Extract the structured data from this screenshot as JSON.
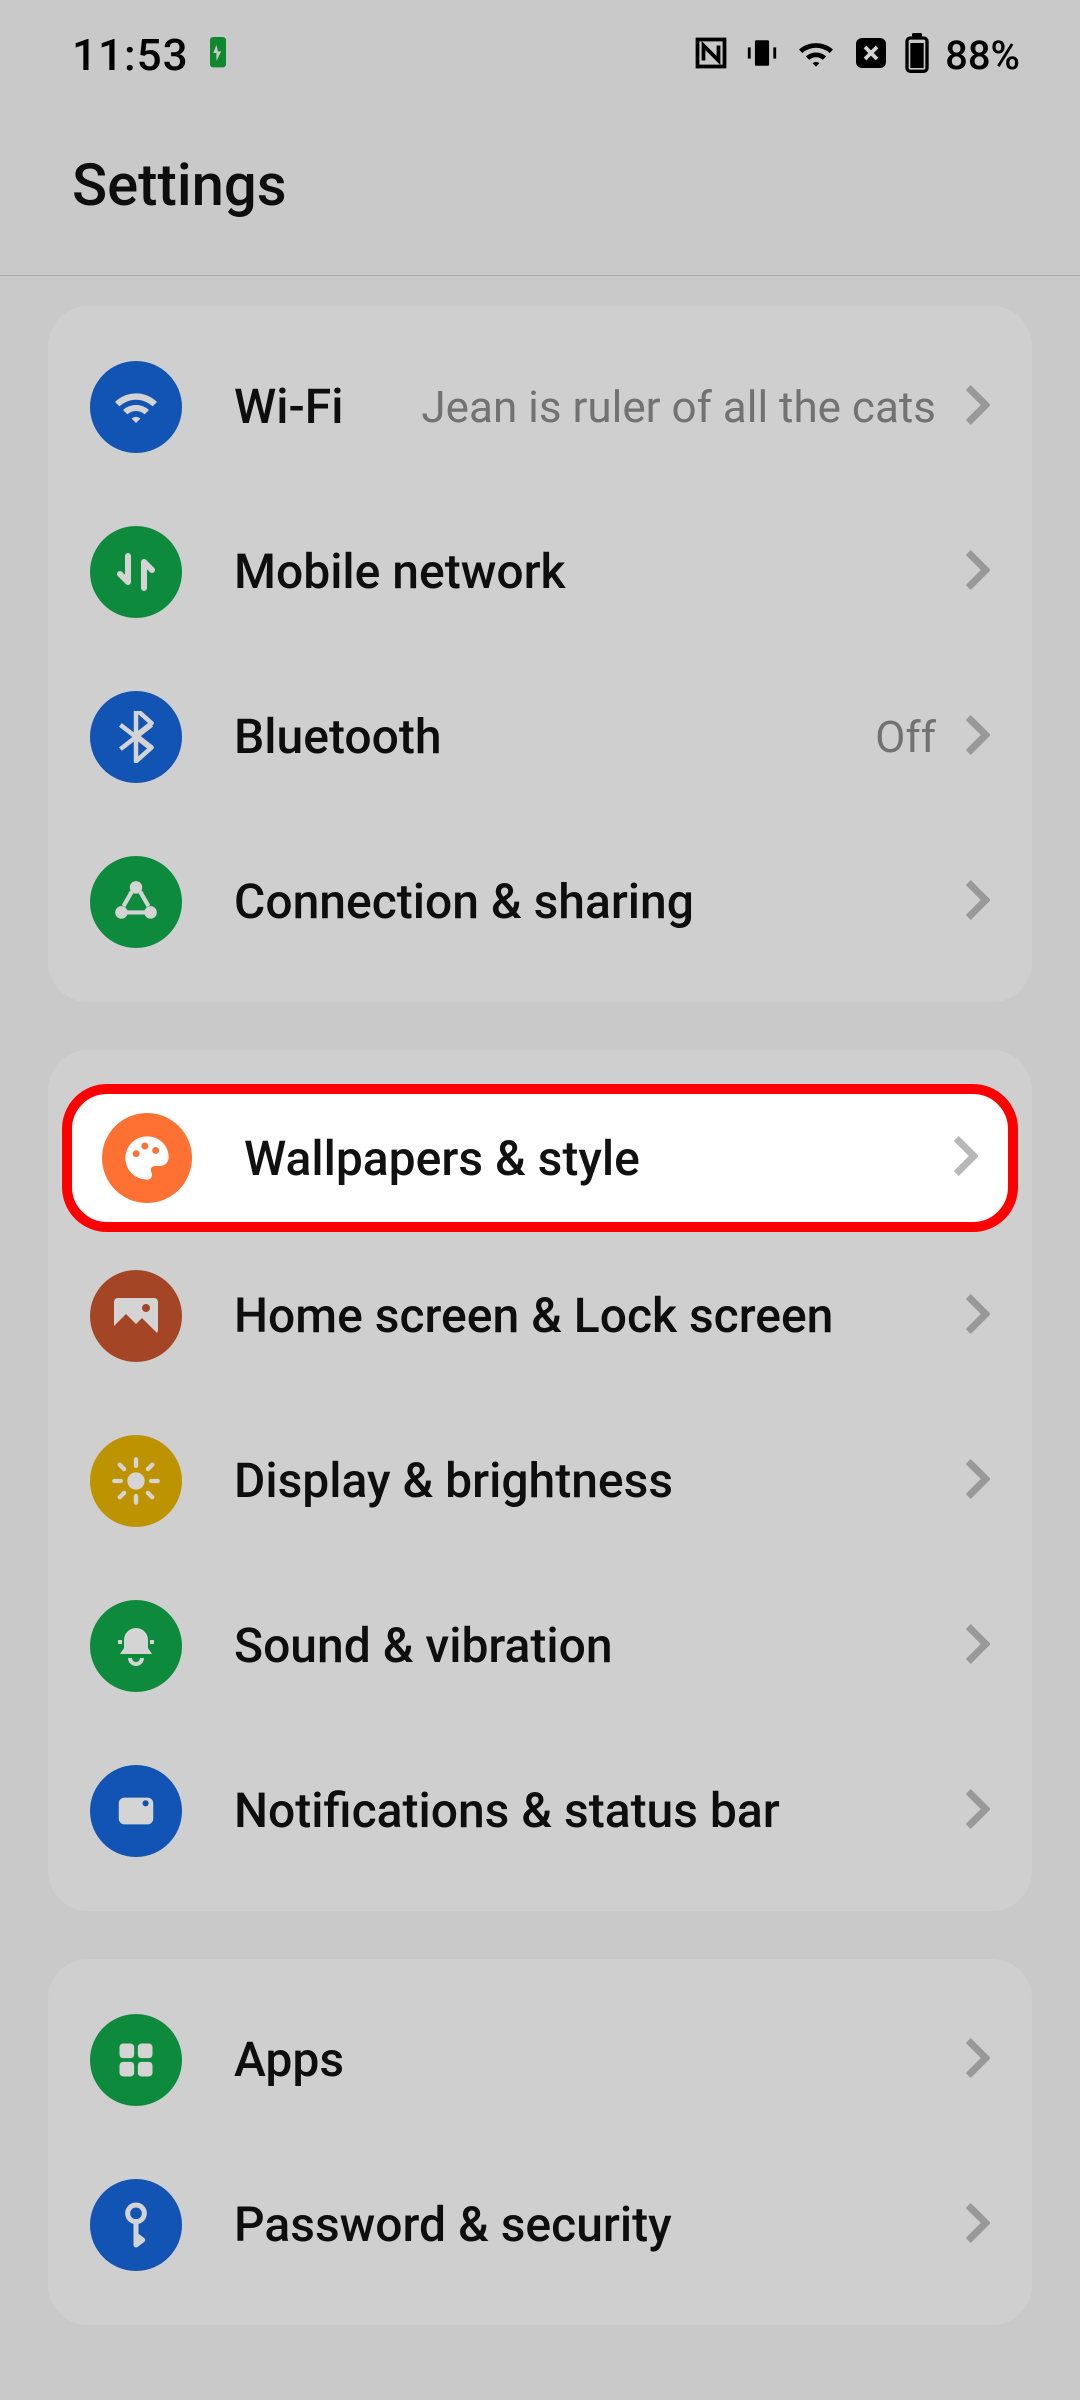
{
  "status_bar": {
    "time": "11:53",
    "battery_pct": "88%"
  },
  "header": {
    "title": "Settings"
  },
  "groups": [
    {
      "items": [
        {
          "id": "wifi",
          "label": "Wi-Fi",
          "value": "Jean is ruler of all the cats",
          "icon": "wifi",
          "color": "blue"
        },
        {
          "id": "mobile-network",
          "label": "Mobile network",
          "value": "",
          "icon": "data",
          "color": "green"
        },
        {
          "id": "bluetooth",
          "label": "Bluetooth",
          "value": "Off",
          "icon": "bluetooth",
          "color": "blue"
        },
        {
          "id": "connection-sharing",
          "label": "Connection & sharing",
          "value": "",
          "icon": "share",
          "color": "green"
        }
      ]
    },
    {
      "items": [
        {
          "id": "wallpapers-style",
          "label": "Wallpapers & style",
          "value": "",
          "icon": "palette",
          "color": "orange",
          "highlighted": true
        },
        {
          "id": "home-lock",
          "label": "Home screen & Lock screen",
          "value": "",
          "icon": "picture",
          "color": "brown"
        },
        {
          "id": "display-brightness",
          "label": "Display & brightness",
          "value": "",
          "icon": "sun",
          "color": "yellow"
        },
        {
          "id": "sound-vibration",
          "label": "Sound & vibration",
          "value": "",
          "icon": "bell",
          "color": "green"
        },
        {
          "id": "notifications",
          "label": "Notifications & status bar",
          "value": "",
          "icon": "tag",
          "color": "blue"
        }
      ]
    },
    {
      "items": [
        {
          "id": "apps",
          "label": "Apps",
          "value": "",
          "icon": "grid",
          "color": "green"
        },
        {
          "id": "password-security",
          "label": "Password & security",
          "value": "",
          "icon": "key",
          "color": "blue"
        }
      ]
    }
  ],
  "highlight": {
    "label": "Wallpapers & style"
  }
}
